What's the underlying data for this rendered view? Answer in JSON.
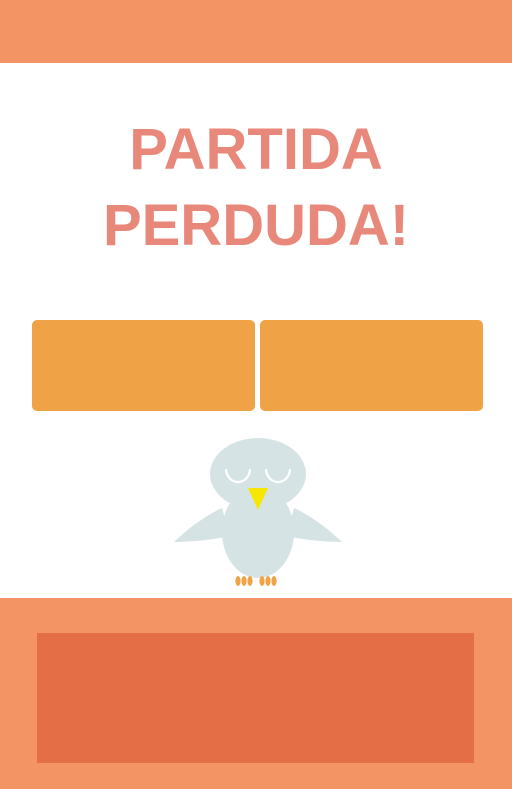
{
  "game": {
    "title_line1": "PARTIDA",
    "title_line2": "PERDUDA!"
  },
  "colors": {
    "header_bar": "#f29463",
    "title_text": "#e8887a",
    "option_button": "#efa346",
    "footer_bar": "#f29463",
    "footer_panel": "#e46f46",
    "owl_body": "#d6e3e4",
    "owl_beak": "#f7e600",
    "owl_feet": "#efa346"
  },
  "icons": {
    "mascot": "sleeping-owl-icon"
  }
}
